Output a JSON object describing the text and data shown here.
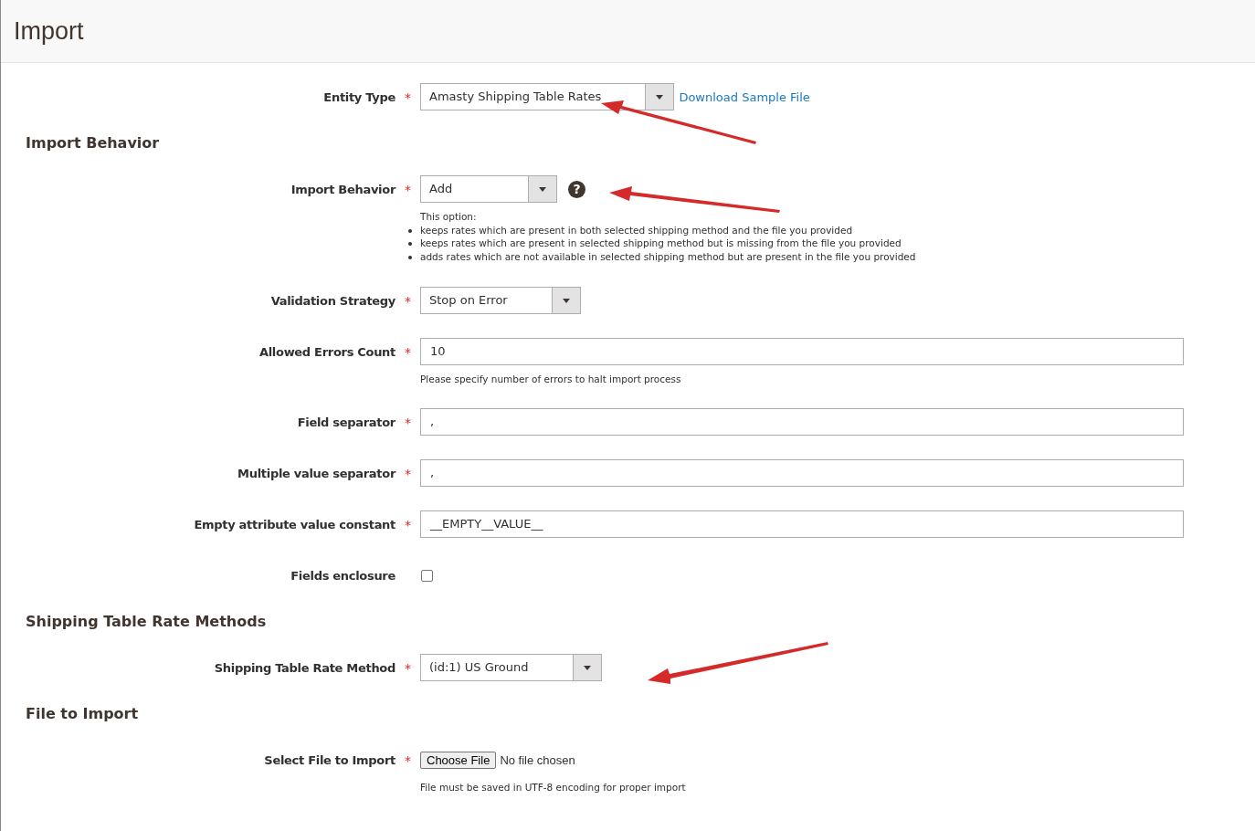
{
  "page_title": "Import",
  "sections": [
    {
      "fields": [
        {
          "kind": "select",
          "label": "Entity Type",
          "required": "*",
          "value": "Amasty Shipping Table Rates",
          "link": "Download Sample File"
        }
      ]
    },
    {
      "heading": "Import Behavior",
      "fields": [
        {
          "kind": "select",
          "label": "Import Behavior",
          "required": "*",
          "value": "Add",
          "help": "?",
          "note_intro": "This option:",
          "note_items": [
            "keeps rates which are present in both selected shipping method and the file you provided",
            "keeps rates which are present in selected shipping method but is missing from the file you provided",
            "adds rates which are not available in selected shipping method but are present in the file you provided"
          ]
        },
        {
          "kind": "select",
          "label": "Validation Strategy",
          "required": "*",
          "value": "Stop on Error"
        },
        {
          "kind": "text",
          "label": "Allowed Errors Count",
          "required": "*",
          "value": "10",
          "note": "Please specify number of errors to halt import process"
        },
        {
          "kind": "text",
          "label": "Field separator",
          "required": "*",
          "value": ","
        },
        {
          "kind": "text",
          "label": "Multiple value separator",
          "required": "*",
          "value": ","
        },
        {
          "kind": "text",
          "label": "Empty attribute value constant",
          "required": "*",
          "value": "__EMPTY__VALUE__"
        },
        {
          "kind": "checkbox",
          "label": "Fields enclosure",
          "checked": false
        }
      ]
    },
    {
      "heading": "Shipping Table Rate Methods",
      "fields": [
        {
          "kind": "select",
          "label": "Shipping Table Rate Method",
          "required": "*",
          "value": "(id:1) US Ground"
        }
      ]
    },
    {
      "heading": "File to Import",
      "fields": [
        {
          "kind": "file",
          "label": "Select File to Import",
          "required": "*",
          "button": "Choose File",
          "value": "No file chosen",
          "note": "File must be saved in UTF-8 encoding for proper import"
        }
      ]
    }
  ]
}
